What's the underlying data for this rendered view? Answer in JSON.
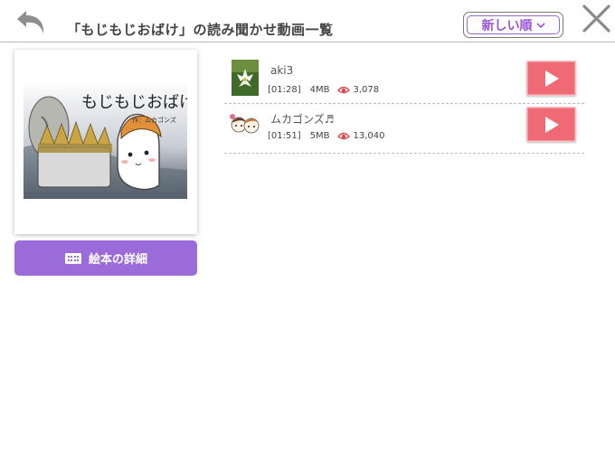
{
  "header": {
    "title": "「もじもじおばけ」の読み聞かせ動画一覧",
    "sort_label": "新しい順",
    "back_icon": "back-arrow-icon",
    "close_icon": "close-icon"
  },
  "book": {
    "cover_title": "もじもじおばけ",
    "cover_author": "作：ムカゴンズ",
    "detail_button_label": "絵本の詳細"
  },
  "videos": [
    {
      "user": "aki3",
      "duration": "[01:28]",
      "size": "4MB",
      "views": "3,078"
    },
    {
      "user": "ムカゴンズ♬",
      "duration": "[01:51]",
      "size": "5MB",
      "views": "13,040"
    }
  ],
  "colors": {
    "accent_purple": "#9b6bd9",
    "play_red": "#ef6a75",
    "views_icon_red": "#e0484f"
  }
}
